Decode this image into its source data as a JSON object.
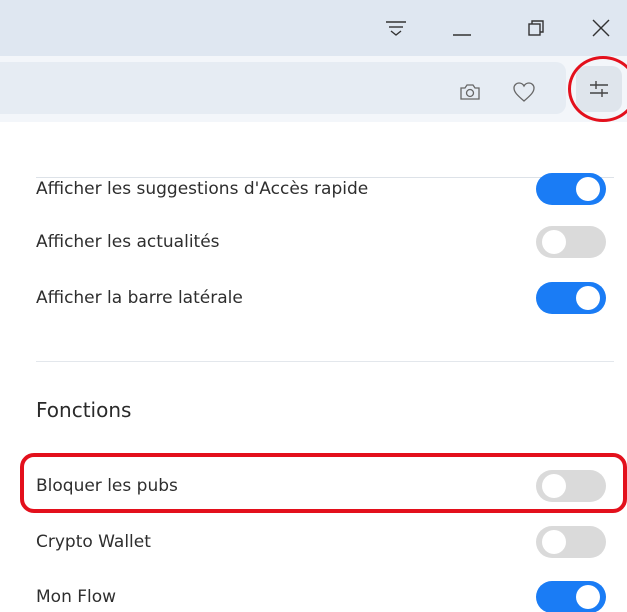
{
  "titlebar": {
    "icons": [
      "menu-icon",
      "minimize-icon",
      "restore-icon",
      "close-icon"
    ]
  },
  "addressbar": {
    "icons": [
      "camera-icon",
      "heart-icon",
      "settings-sliders-icon"
    ]
  },
  "display": {
    "items": [
      {
        "label": "Afficher les suggestions d'Accès rapide",
        "on": true
      },
      {
        "label": "Afficher les actualités",
        "on": false
      },
      {
        "label": "Afficher la barre latérale",
        "on": true
      }
    ]
  },
  "features": {
    "title": "Fonctions",
    "items": [
      {
        "label": "Bloquer les pubs",
        "on": false
      },
      {
        "label": "Crypto Wallet",
        "on": false
      },
      {
        "label": "Mon Flow",
        "on": true
      }
    ]
  },
  "colors": {
    "accent": "#1a7cf5",
    "highlight": "#e3101c",
    "toggle_off": "#dadada"
  }
}
